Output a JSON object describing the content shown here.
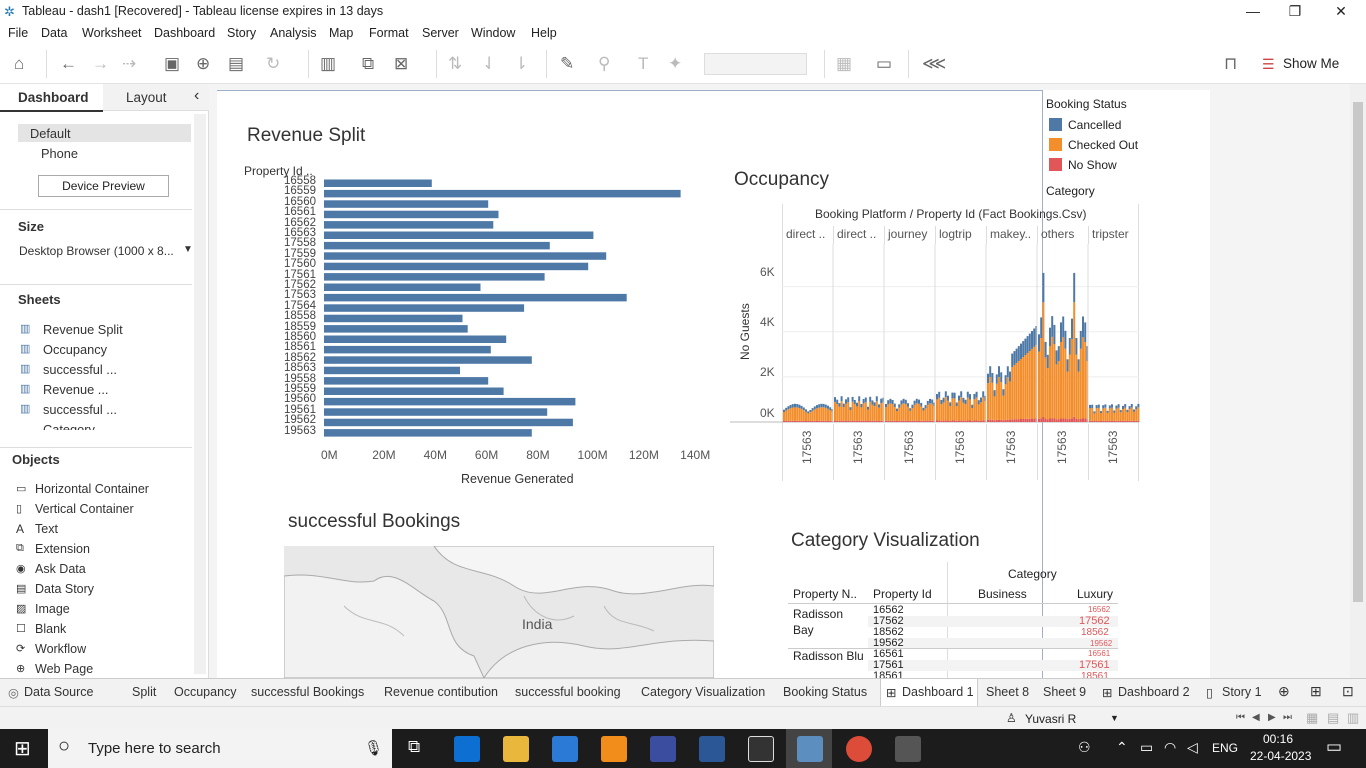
{
  "window": {
    "title": "Tableau - dash1 [Recovered] - Tableau license expires in 13 days",
    "min": "—",
    "max": "❐",
    "close": "✕"
  },
  "menu": [
    "File",
    "Data",
    "Worksheet",
    "Dashboard",
    "Story",
    "Analysis",
    "Map",
    "Format",
    "Server",
    "Window",
    "Help"
  ],
  "toolbar": {
    "show_me": "Show Me"
  },
  "sidebar": {
    "tab_dashboard": "Dashboard",
    "tab_layout": "Layout",
    "collapse": "‹",
    "device_default": "Default",
    "device_phone": "Phone",
    "device_preview": "Device Preview",
    "size_header": "Size",
    "size_value": "Desktop Browser (1000 x 8...",
    "sheets_header": "Sheets",
    "sheets": [
      "Revenue Split",
      "Occupancy",
      "successful ...",
      "Revenue ...",
      "successful ...",
      "Category"
    ],
    "objects_header": "Objects",
    "objects": [
      "Horizontal Container",
      "Vertical Container",
      "Text",
      "Extension",
      "Ask Data",
      "Data Story",
      "Image",
      "Blank",
      "Workflow",
      "Web Page"
    ]
  },
  "revenue": {
    "title": "Revenue Split",
    "y_header": "Property Id ..",
    "x_title": "Revenue Generated",
    "chart_data": {
      "type": "bar",
      "orientation": "horizontal",
      "categories": [
        "16558",
        "16559",
        "16560",
        "16561",
        "16562",
        "16563",
        "17558",
        "17559",
        "17560",
        "17561",
        "17562",
        "17563",
        "17564",
        "18558",
        "18559",
        "18560",
        "18561",
        "18562",
        "18563",
        "19558",
        "19559",
        "19560",
        "19561",
        "19562",
        "19563"
      ],
      "values": [
        42,
        139,
        64,
        68,
        66,
        105,
        88,
        110,
        103,
        86,
        61,
        118,
        78,
        54,
        56,
        71,
        65,
        81,
        53,
        64,
        70,
        98,
        87,
        97,
        81
      ],
      "xlabel": "Revenue Generated",
      "xlim": [
        0,
        145
      ],
      "ticks": [
        "0M",
        "20M",
        "40M",
        "60M",
        "80M",
        "100M",
        "120M",
        "140M"
      ]
    }
  },
  "occupancy": {
    "title": "Occupancy",
    "header": "Booking Platform / Property Id (Fact Bookings.Csv)",
    "platforms": [
      "direct ..",
      "direct ..",
      "journey",
      "logtrip",
      "makey..",
      "others",
      "tripster"
    ],
    "y_title": "No Guests",
    "y_ticks": [
      "6K",
      "4K",
      "2K",
      "0K"
    ],
    "x_tick": "17563",
    "chart_data": {
      "type": "bar",
      "stacked": true,
      "series": [
        "Cancelled",
        "Checked Out",
        "No Show"
      ],
      "panels": [
        {
          "platform": "direct ..",
          "level": 700
        },
        {
          "platform": "direct ..",
          "level": 1000
        },
        {
          "platform": "journey",
          "level": 900
        },
        {
          "platform": "logtrip",
          "level": 1200
        },
        {
          "platform": "makey..",
          "level": 2200
        },
        {
          "platform": "others",
          "level": 4200
        },
        {
          "platform": "tripster",
          "level": 700
        }
      ],
      "ylim": [
        0,
        7000
      ]
    }
  },
  "legend": {
    "title": "Booking Status",
    "items": [
      {
        "label": "Cancelled",
        "color": "#4e79a7"
      },
      {
        "label": "Checked Out",
        "color": "#f28e2b"
      },
      {
        "label": "No Show",
        "color": "#e15759"
      }
    ],
    "category": "Category"
  },
  "bookings": {
    "title": "successful Bookings",
    "map_label": "India"
  },
  "category": {
    "title": "Category Visualization",
    "header_category": "Category",
    "col_name": "Property N..",
    "col_id": "Property Id",
    "col_business": "Business",
    "col_luxury": "Luxury",
    "rows": [
      {
        "name": "Radisson Bay",
        "ids": [
          "16562",
          "17562",
          "18562",
          "19562"
        ],
        "lux": [
          "16562",
          "17562",
          "18562",
          "19562"
        ]
      },
      {
        "name": "Radisson Blu",
        "ids": [
          "16561",
          "17561",
          "18561"
        ],
        "lux": [
          "16561",
          "17561",
          "18561"
        ]
      }
    ]
  },
  "tabs": [
    "Data Source",
    "Split",
    "Occupancy",
    "successful Bookings",
    "Revenue contibution",
    "successful booking",
    "Category Visualization",
    "Booking Status",
    "Dashboard 1",
    "Sheet 8",
    "Sheet 9",
    "Dashboard 2",
    "Story 1"
  ],
  "status": {
    "user": "Yuvasri R"
  },
  "taskbar": {
    "search": "Type here to search",
    "lang": "ENG",
    "time": "00:16",
    "date": "22-04-2023"
  }
}
